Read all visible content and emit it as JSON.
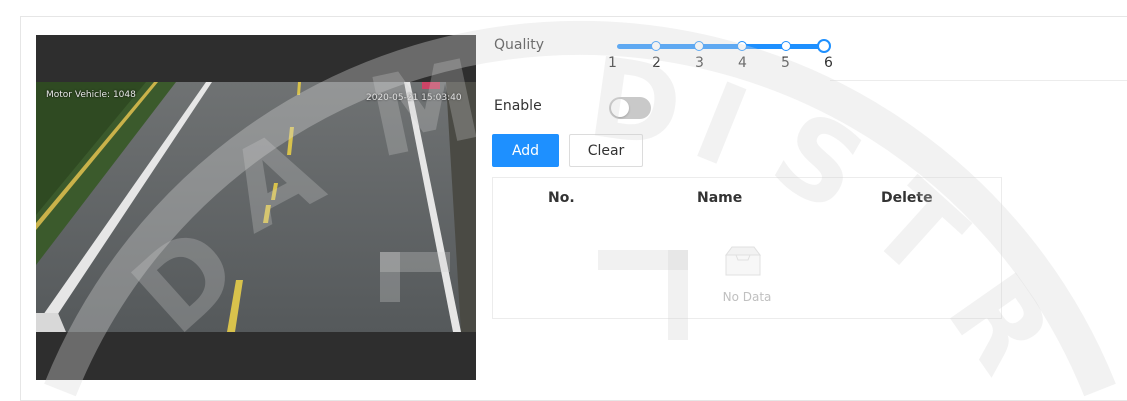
{
  "video": {
    "osd_left": "Motor Vehicle: 1048",
    "osd_right": "2020-05-21 15:03:40"
  },
  "quality": {
    "label": "Quality",
    "ticks": [
      "1",
      "2",
      "3",
      "4",
      "5",
      "6"
    ],
    "selected": "6"
  },
  "enable": {
    "label": "Enable",
    "state": "off"
  },
  "buttons": {
    "add": "Add",
    "clear": "Clear"
  },
  "table": {
    "columns": [
      "No.",
      "Name",
      "Delete"
    ],
    "empty_text": "No Data",
    "rows": []
  },
  "watermark": {
    "text": "DAM DISTRIBUTION"
  },
  "colors": {
    "accent": "#1e90ff",
    "toggle_off": "#c9c9c9"
  }
}
